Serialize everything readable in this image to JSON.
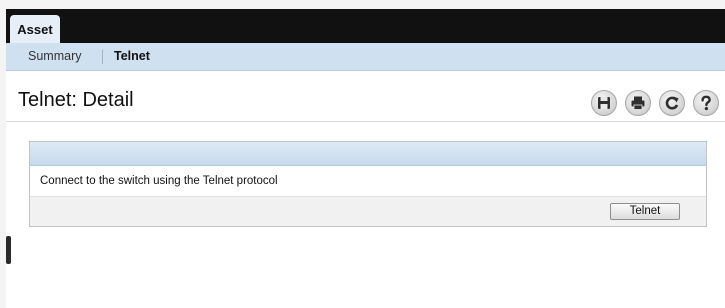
{
  "tabs": {
    "active_label": "Asset"
  },
  "subtabs": {
    "summary": "Summary",
    "telnet": "Telnet"
  },
  "page": {
    "title": "Telnet: Detail"
  },
  "toolbar": {
    "icons": [
      "save-icon",
      "print-icon",
      "refresh-icon",
      "help-icon"
    ]
  },
  "panel": {
    "description": "Connect to the switch using the Telnet protocol",
    "button_label": "Telnet"
  },
  "colors": {
    "tabbar": "#111111",
    "subtab_bar": "#cfe0f1",
    "panel_header": "#c6d9ec"
  }
}
